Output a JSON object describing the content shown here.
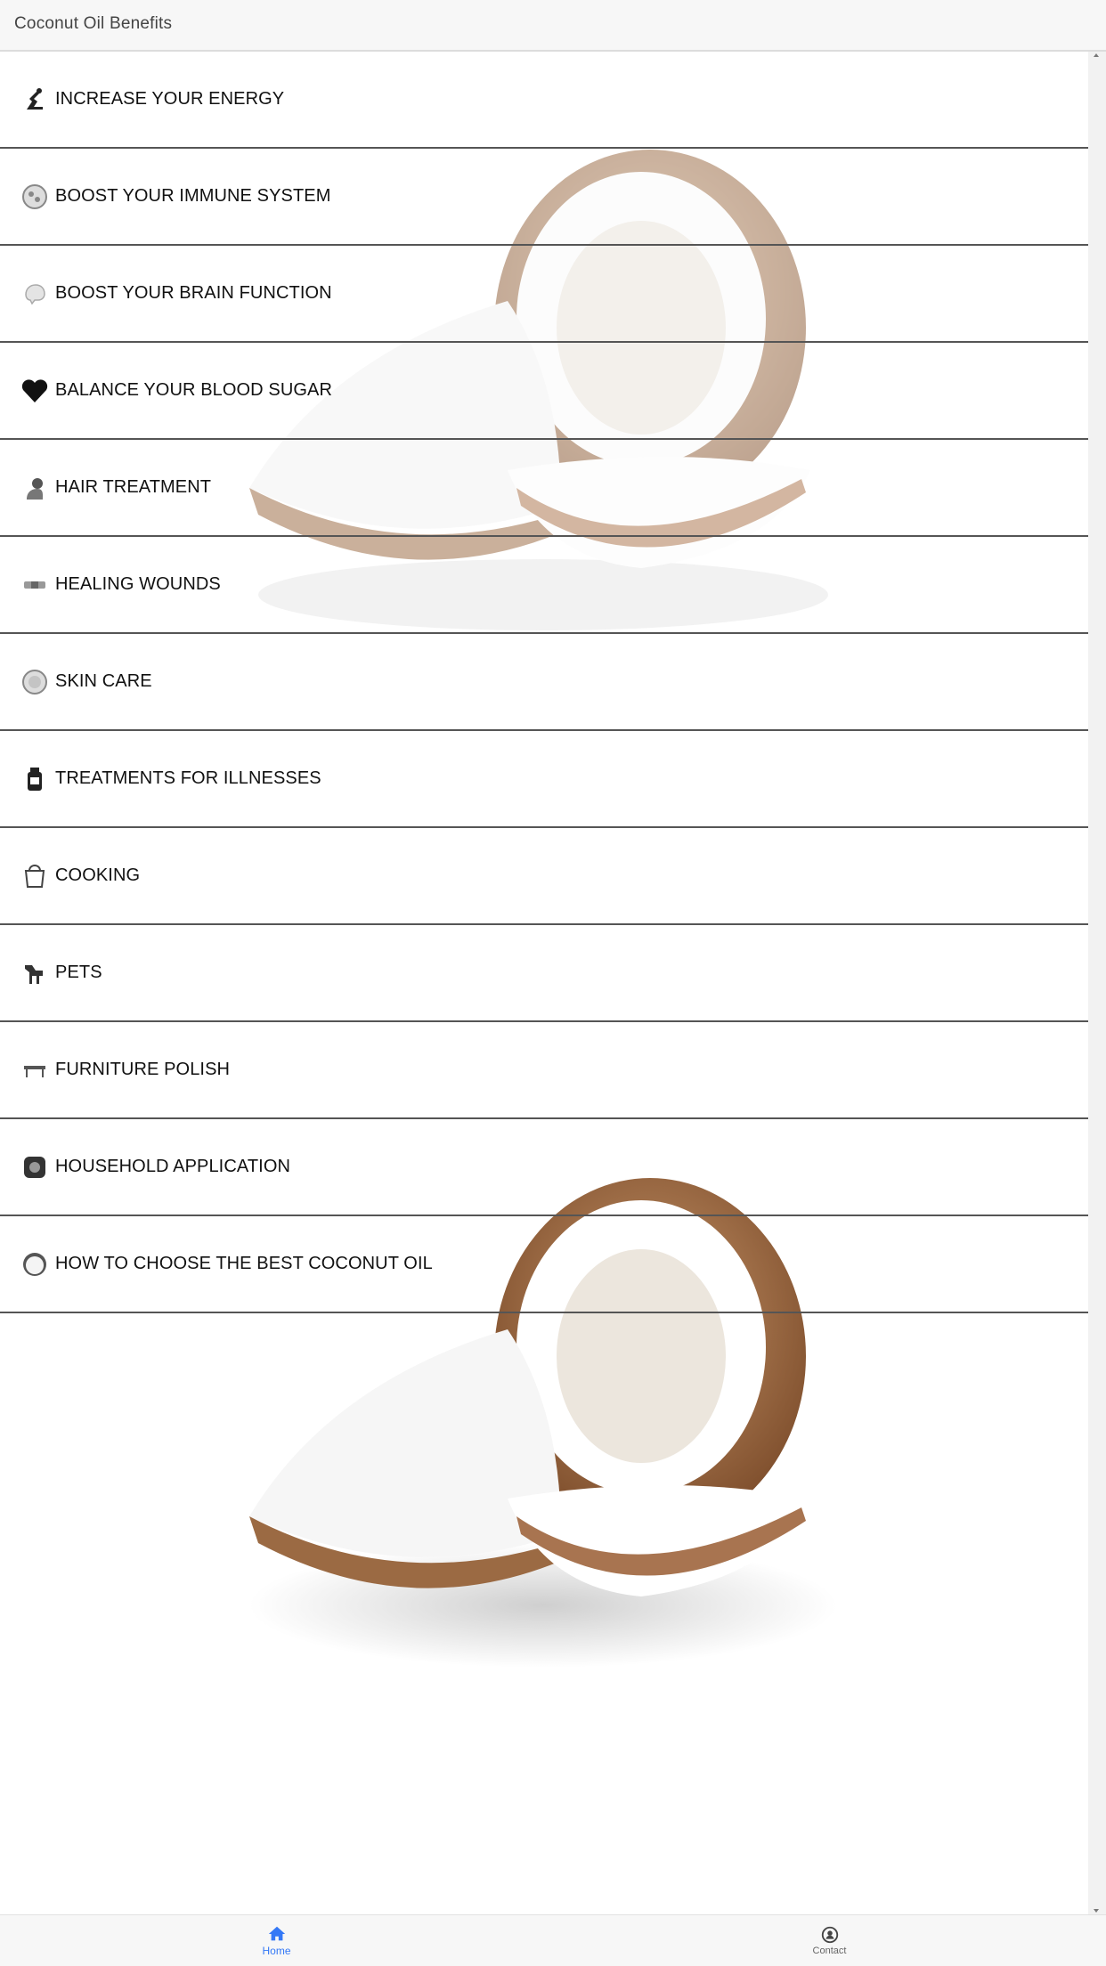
{
  "app": {
    "title": "Coconut Oil Benefits"
  },
  "colors": {
    "accent": "#3478f6",
    "divider": "#555555",
    "text": "#111111"
  },
  "menu": {
    "items": [
      {
        "label": "INCREASE YOUR ENERGY",
        "icon": "energy-icon"
      },
      {
        "label": "BOOST YOUR IMMUNE SYSTEM",
        "icon": "immune-icon"
      },
      {
        "label": "BOOST YOUR BRAIN FUNCTION",
        "icon": "brain-icon"
      },
      {
        "label": "BALANCE YOUR BLOOD SUGAR",
        "icon": "heart-icon"
      },
      {
        "label": "HAIR TREATMENT",
        "icon": "hair-icon"
      },
      {
        "label": "HEALING WOUNDS",
        "icon": "bandage-icon"
      },
      {
        "label": "SKIN CARE",
        "icon": "skin-icon"
      },
      {
        "label": "TREATMENTS FOR ILLNESSES",
        "icon": "medicine-bottle-icon"
      },
      {
        "label": "COOKING",
        "icon": "cooking-pot-icon"
      },
      {
        "label": "PETS",
        "icon": "pet-icon"
      },
      {
        "label": "FURNITURE POLISH",
        "icon": "furniture-icon"
      },
      {
        "label": "HOUSEHOLD APPLICATION",
        "icon": "household-icon"
      },
      {
        "label": "HOW TO CHOOSE THE BEST COCONUT OIL",
        "icon": "coconut-icon"
      }
    ]
  },
  "tabs": [
    {
      "label": "Home",
      "icon": "home-icon",
      "active": true
    },
    {
      "label": "Contact",
      "icon": "contact-icon",
      "active": false
    }
  ]
}
